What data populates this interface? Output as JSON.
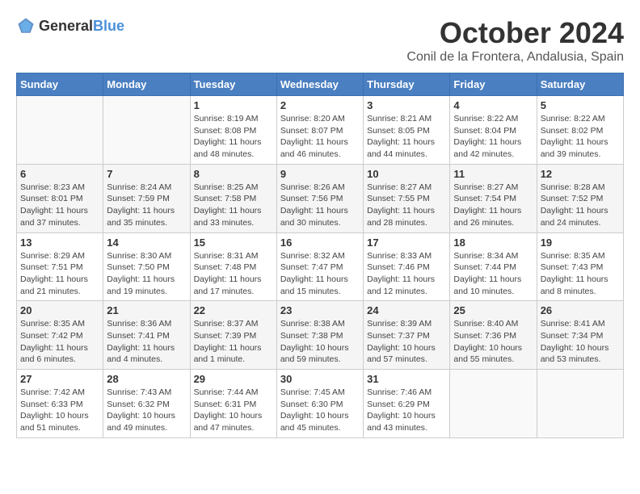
{
  "logo": {
    "general": "General",
    "blue": "Blue"
  },
  "title": "October 2024",
  "location": "Conil de la Frontera, Andalusia, Spain",
  "days_of_week": [
    "Sunday",
    "Monday",
    "Tuesday",
    "Wednesday",
    "Thursday",
    "Friday",
    "Saturday"
  ],
  "weeks": [
    [
      {
        "day": "",
        "info": ""
      },
      {
        "day": "",
        "info": ""
      },
      {
        "day": "1",
        "info": "Sunrise: 8:19 AM\nSunset: 8:08 PM\nDaylight: 11 hours and 48 minutes."
      },
      {
        "day": "2",
        "info": "Sunrise: 8:20 AM\nSunset: 8:07 PM\nDaylight: 11 hours and 46 minutes."
      },
      {
        "day": "3",
        "info": "Sunrise: 8:21 AM\nSunset: 8:05 PM\nDaylight: 11 hours and 44 minutes."
      },
      {
        "day": "4",
        "info": "Sunrise: 8:22 AM\nSunset: 8:04 PM\nDaylight: 11 hours and 42 minutes."
      },
      {
        "day": "5",
        "info": "Sunrise: 8:22 AM\nSunset: 8:02 PM\nDaylight: 11 hours and 39 minutes."
      }
    ],
    [
      {
        "day": "6",
        "info": "Sunrise: 8:23 AM\nSunset: 8:01 PM\nDaylight: 11 hours and 37 minutes."
      },
      {
        "day": "7",
        "info": "Sunrise: 8:24 AM\nSunset: 7:59 PM\nDaylight: 11 hours and 35 minutes."
      },
      {
        "day": "8",
        "info": "Sunrise: 8:25 AM\nSunset: 7:58 PM\nDaylight: 11 hours and 33 minutes."
      },
      {
        "day": "9",
        "info": "Sunrise: 8:26 AM\nSunset: 7:56 PM\nDaylight: 11 hours and 30 minutes."
      },
      {
        "day": "10",
        "info": "Sunrise: 8:27 AM\nSunset: 7:55 PM\nDaylight: 11 hours and 28 minutes."
      },
      {
        "day": "11",
        "info": "Sunrise: 8:27 AM\nSunset: 7:54 PM\nDaylight: 11 hours and 26 minutes."
      },
      {
        "day": "12",
        "info": "Sunrise: 8:28 AM\nSunset: 7:52 PM\nDaylight: 11 hours and 24 minutes."
      }
    ],
    [
      {
        "day": "13",
        "info": "Sunrise: 8:29 AM\nSunset: 7:51 PM\nDaylight: 11 hours and 21 minutes."
      },
      {
        "day": "14",
        "info": "Sunrise: 8:30 AM\nSunset: 7:50 PM\nDaylight: 11 hours and 19 minutes."
      },
      {
        "day": "15",
        "info": "Sunrise: 8:31 AM\nSunset: 7:48 PM\nDaylight: 11 hours and 17 minutes."
      },
      {
        "day": "16",
        "info": "Sunrise: 8:32 AM\nSunset: 7:47 PM\nDaylight: 11 hours and 15 minutes."
      },
      {
        "day": "17",
        "info": "Sunrise: 8:33 AM\nSunset: 7:46 PM\nDaylight: 11 hours and 12 minutes."
      },
      {
        "day": "18",
        "info": "Sunrise: 8:34 AM\nSunset: 7:44 PM\nDaylight: 11 hours and 10 minutes."
      },
      {
        "day": "19",
        "info": "Sunrise: 8:35 AM\nSunset: 7:43 PM\nDaylight: 11 hours and 8 minutes."
      }
    ],
    [
      {
        "day": "20",
        "info": "Sunrise: 8:35 AM\nSunset: 7:42 PM\nDaylight: 11 hours and 6 minutes."
      },
      {
        "day": "21",
        "info": "Sunrise: 8:36 AM\nSunset: 7:41 PM\nDaylight: 11 hours and 4 minutes."
      },
      {
        "day": "22",
        "info": "Sunrise: 8:37 AM\nSunset: 7:39 PM\nDaylight: 11 hours and 1 minute."
      },
      {
        "day": "23",
        "info": "Sunrise: 8:38 AM\nSunset: 7:38 PM\nDaylight: 10 hours and 59 minutes."
      },
      {
        "day": "24",
        "info": "Sunrise: 8:39 AM\nSunset: 7:37 PM\nDaylight: 10 hours and 57 minutes."
      },
      {
        "day": "25",
        "info": "Sunrise: 8:40 AM\nSunset: 7:36 PM\nDaylight: 10 hours and 55 minutes."
      },
      {
        "day": "26",
        "info": "Sunrise: 8:41 AM\nSunset: 7:34 PM\nDaylight: 10 hours and 53 minutes."
      }
    ],
    [
      {
        "day": "27",
        "info": "Sunrise: 7:42 AM\nSunset: 6:33 PM\nDaylight: 10 hours and 51 minutes."
      },
      {
        "day": "28",
        "info": "Sunrise: 7:43 AM\nSunset: 6:32 PM\nDaylight: 10 hours and 49 minutes."
      },
      {
        "day": "29",
        "info": "Sunrise: 7:44 AM\nSunset: 6:31 PM\nDaylight: 10 hours and 47 minutes."
      },
      {
        "day": "30",
        "info": "Sunrise: 7:45 AM\nSunset: 6:30 PM\nDaylight: 10 hours and 45 minutes."
      },
      {
        "day": "31",
        "info": "Sunrise: 7:46 AM\nSunset: 6:29 PM\nDaylight: 10 hours and 43 minutes."
      },
      {
        "day": "",
        "info": ""
      },
      {
        "day": "",
        "info": ""
      }
    ]
  ]
}
